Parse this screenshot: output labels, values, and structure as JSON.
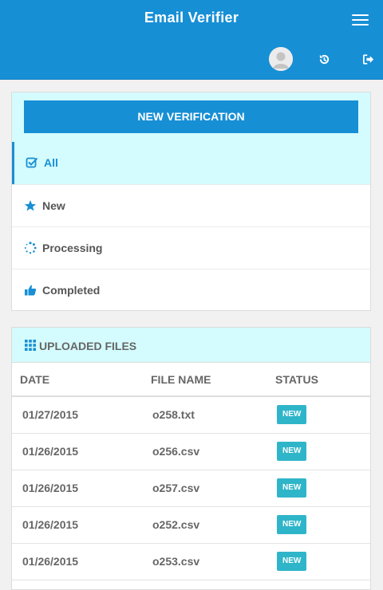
{
  "header": {
    "title": "Email Verifier",
    "icons": [
      "menu-icon",
      "avatar",
      "history-icon",
      "logout-icon"
    ]
  },
  "actions": {
    "new_verification": "NEW VERIFICATION"
  },
  "filters": [
    {
      "label": "All",
      "icon": "check-square-icon",
      "active": true
    },
    {
      "label": "New",
      "icon": "star-icon",
      "active": false
    },
    {
      "label": "Processing",
      "icon": "spinner-icon",
      "active": false
    },
    {
      "label": "Completed",
      "icon": "thumbs-up-icon",
      "active": false
    }
  ],
  "uploaded_files": {
    "title": "UPLOADED FILES",
    "columns": [
      "DATE",
      "FILE NAME",
      "STATUS"
    ],
    "rows": [
      {
        "date": "01/27/2015",
        "file": "o258.txt",
        "status": "NEW"
      },
      {
        "date": "01/26/2015",
        "file": "o256.csv",
        "status": "NEW"
      },
      {
        "date": "01/26/2015",
        "file": "o257.csv",
        "status": "NEW"
      },
      {
        "date": "01/26/2015",
        "file": "o252.csv",
        "status": "NEW"
      },
      {
        "date": "01/26/2015",
        "file": "o253.csv",
        "status": "NEW"
      }
    ]
  },
  "colors": {
    "primary": "#178fd5",
    "highlight": "#d4fbfd",
    "badge": "#2fb5c9"
  }
}
